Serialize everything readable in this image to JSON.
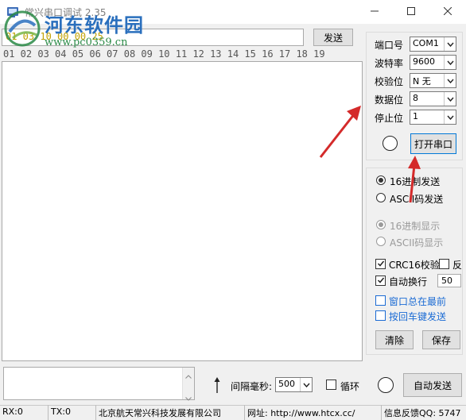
{
  "window": {
    "title": "常兴串口调试 2.35",
    "controls": {
      "minimize": "minimize-icon",
      "maximize": "maximize-icon",
      "close": "close-icon"
    }
  },
  "watermark": {
    "title": "河东软件园",
    "url": "www.pc0359.cn"
  },
  "send_row": {
    "input_value": "01 03 10 00 00 25",
    "send_label": "发送"
  },
  "ruler": "01 02 03 04 05 06 07 08 09 10 11 12 13 14 15 16 17 18 19",
  "port": {
    "fields": [
      {
        "label": "端口号",
        "value": "COM1"
      },
      {
        "label": "波特率",
        "value": "9600"
      },
      {
        "label": "校验位",
        "value": "N 无"
      },
      {
        "label": "数据位",
        "value": "8"
      },
      {
        "label": "停止位",
        "value": "1"
      }
    ],
    "open_label": "打开串口"
  },
  "send_mode": {
    "hex": {
      "label": "16进制发送",
      "selected": true
    },
    "ascii": {
      "label": "ASCII码发送",
      "selected": false
    }
  },
  "display_mode": {
    "hex": {
      "label": "16进制显示",
      "selected": true
    },
    "ascii": {
      "label": "ASCII码显示",
      "selected": false
    }
  },
  "options": {
    "crc16": {
      "label": "CRC16校验",
      "checked": true
    },
    "reverse": {
      "label": "反",
      "checked": false
    },
    "auto_newline": {
      "label": "自动换行",
      "checked": true,
      "count": "50"
    },
    "always_on_top": {
      "label": "窗口总在最前",
      "checked": false
    },
    "enter_to_send": {
      "label": "按回车键发送",
      "checked": false
    }
  },
  "buttons": {
    "clear": "清除",
    "save": "保存"
  },
  "bottom": {
    "interval_label": "间隔毫秒:",
    "interval_value": "500",
    "loop_label": "循环",
    "auto_send_label": "自动发送"
  },
  "status": {
    "rx": "RX:0",
    "tx": "TX:0",
    "company": "北京航天常兴科技发展有限公司",
    "website": "网址: http://www.htcx.cc/",
    "feedback": "信息反馈QQ: 5747"
  },
  "colors": {
    "hex_text": "#c0a000",
    "watermark_blue": "#2a6fbd",
    "watermark_green": "#2a8a46",
    "link_blue": "#1b6bd4",
    "arrow_red": "#d42a2a"
  }
}
